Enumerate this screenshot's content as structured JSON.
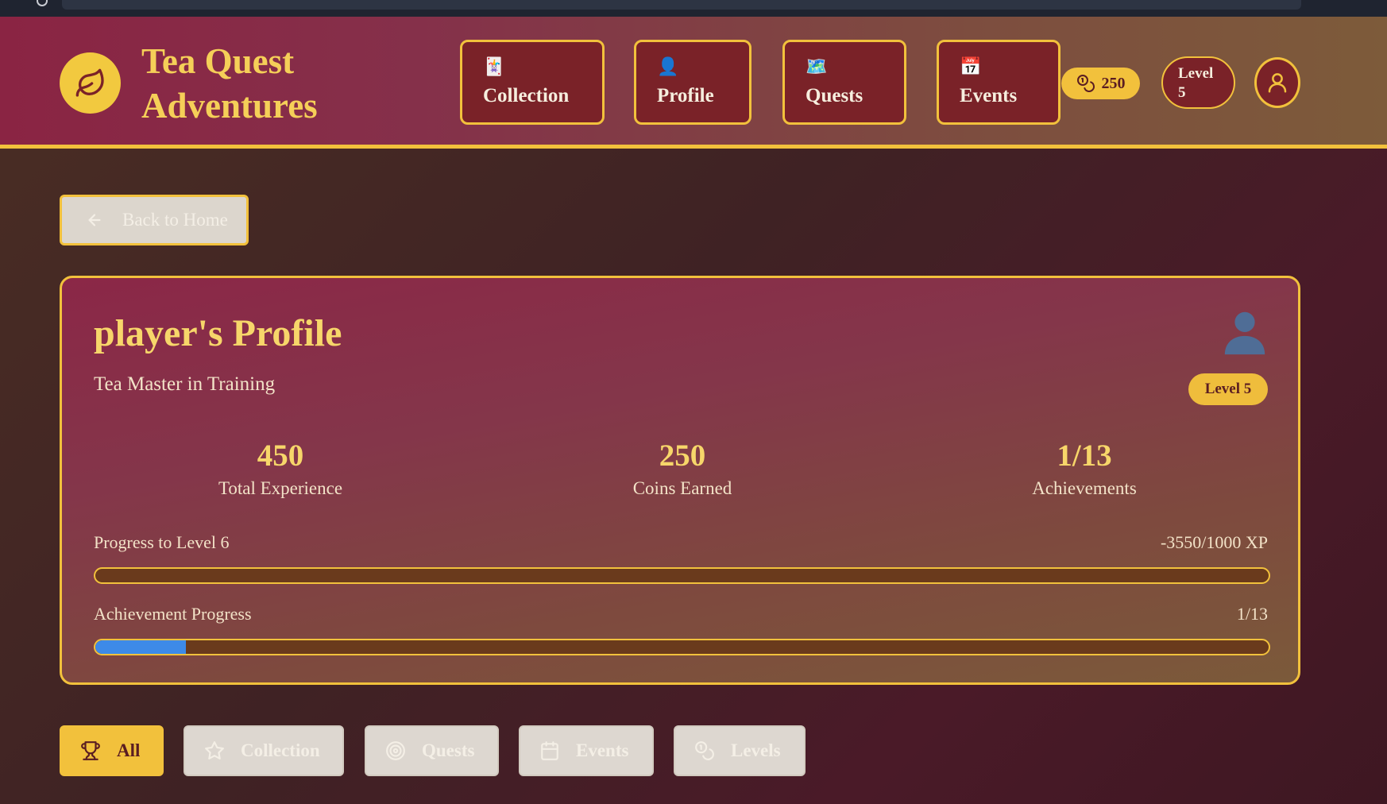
{
  "app": {
    "brand_line1": "Tea Quest",
    "brand_line2": "Adventures",
    "accent_color": "#f2c13c",
    "primary_color": "#7a2228"
  },
  "nav": {
    "items": [
      {
        "label": "Collection",
        "emoji": "🃏"
      },
      {
        "label": "Profile",
        "emoji": "👤"
      },
      {
        "label": "Quests",
        "emoji": "🗺️"
      },
      {
        "label": "Events",
        "emoji": "📅"
      }
    ],
    "coins": "250",
    "level_line1": "Level",
    "level_line2": "5"
  },
  "back": {
    "label": "Back to Home"
  },
  "profile": {
    "title": "player's Profile",
    "subtitle": "Tea Master in Training",
    "level_badge": "Level 5",
    "stats": [
      {
        "value": "450",
        "label": "Total Experience"
      },
      {
        "value": "250",
        "label": "Coins Earned"
      },
      {
        "value": "1/13",
        "label": "Achievements"
      }
    ],
    "level_progress": {
      "label": "Progress to Level 6",
      "value_text": "-3550/1000 XP",
      "fraction": 0
    },
    "achievement_progress": {
      "label": "Achievement Progress",
      "value_text": "1/13",
      "fraction": 0.0769
    }
  },
  "filters": {
    "tabs": [
      {
        "label": "All",
        "icon": "trophy-icon",
        "active": true
      },
      {
        "label": "Collection",
        "icon": "star-icon",
        "active": false
      },
      {
        "label": "Quests",
        "icon": "target-icon",
        "active": false
      },
      {
        "label": "Events",
        "icon": "calendar-icon",
        "active": false
      },
      {
        "label": "Levels",
        "icon": "coins-icon",
        "active": false
      }
    ]
  }
}
